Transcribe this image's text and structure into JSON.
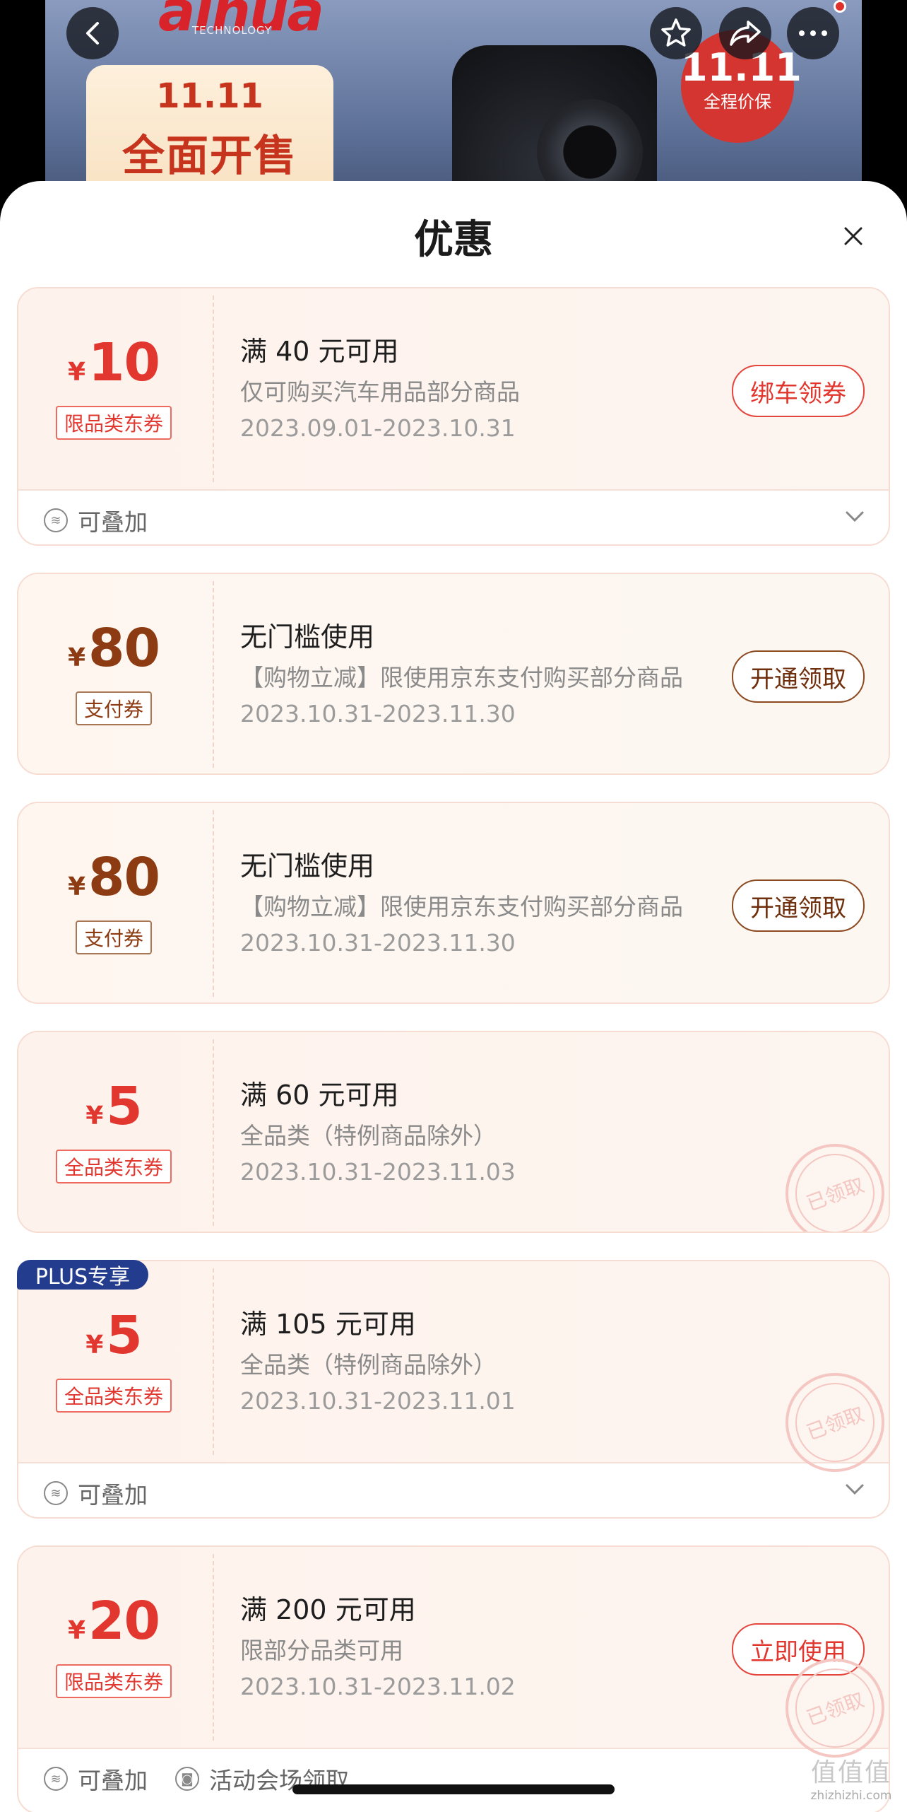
{
  "banner": {
    "brand": "alhua",
    "brand_sub": "TECHNOLOGY",
    "promo_date": "11.11",
    "promo_title": "全面开售",
    "badge_date": "11.11",
    "badge_text": "全程价保",
    "icons": [
      "back-icon",
      "star-icon",
      "share-icon",
      "more-icon"
    ]
  },
  "sheet": {
    "title": "优惠",
    "close_icon": "close-icon"
  },
  "coupons": [
    {
      "currency": "¥",
      "amount": "10",
      "type": "限品类东券",
      "condition": "满 40 元可用",
      "description": "仅可购买汽车用品部分商品",
      "validity": "2023.09.01-2023.10.31",
      "action": "绑车领券",
      "stack_label": "可叠加"
    },
    {
      "currency": "¥",
      "amount": "80",
      "type": "支付券",
      "condition": "无门槛使用",
      "description": "【购物立减】限使用京东支付购买部分商品",
      "validity": "2023.10.31-2023.11.30",
      "action": "开通领取"
    },
    {
      "currency": "¥",
      "amount": "80",
      "type": "支付券",
      "condition": "无门槛使用",
      "description": "【购物立减】限使用京东支付购买部分商品",
      "validity": "2023.10.31-2023.11.30",
      "action": "开通领取"
    },
    {
      "currency": "¥",
      "amount": "5",
      "type": "全品类东券",
      "condition": "满 60 元可用",
      "description": "全品类（特例商品除外）",
      "validity": "2023.10.31-2023.11.03",
      "stamp": "已领取"
    },
    {
      "badge": "PLUS专享",
      "currency": "¥",
      "amount": "5",
      "type": "全品类东券",
      "condition": "满 105 元可用",
      "description": "全品类（特例商品除外）",
      "validity": "2023.10.31-2023.11.01",
      "stamp": "已领取",
      "stack_label": "可叠加"
    },
    {
      "currency": "¥",
      "amount": "20",
      "type": "限品类东券",
      "condition": "满 200 元可用",
      "description": "限部分品类可用",
      "validity": "2023.10.31-2023.11.02",
      "action": "立即使用",
      "stamp": "已领取",
      "stack_label": "可叠加",
      "extra_label": "活动会场领取"
    }
  ],
  "watermark": {
    "logo": "值值值",
    "site": "zhizhizhi.com"
  }
}
